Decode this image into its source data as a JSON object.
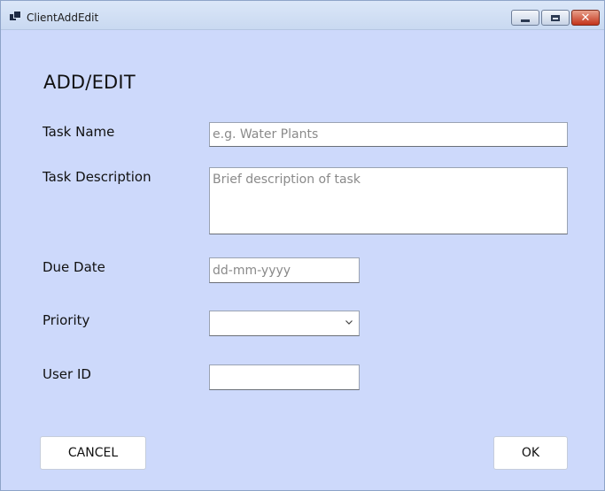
{
  "window": {
    "title": "ClientAddEdit",
    "controls": {
      "minimize": "minimize-icon",
      "maximize": "maximize-icon",
      "close": "close-icon"
    }
  },
  "form": {
    "heading": "ADD/EDIT",
    "task_name": {
      "label": "Task Name",
      "placeholder": "e.g. Water Plants",
      "value": ""
    },
    "task_description": {
      "label": "Task Description",
      "placeholder": "Brief description of task",
      "value": ""
    },
    "due_date": {
      "label": "Due Date",
      "placeholder": "dd-mm-yyyy",
      "value": ""
    },
    "priority": {
      "label": "Priority",
      "selected": ""
    },
    "user_id": {
      "label": "User ID",
      "value": ""
    }
  },
  "buttons": {
    "cancel": "CANCEL",
    "ok": "OK"
  },
  "colors": {
    "background": "#cdd9fb",
    "close_button": "#c3331a"
  }
}
